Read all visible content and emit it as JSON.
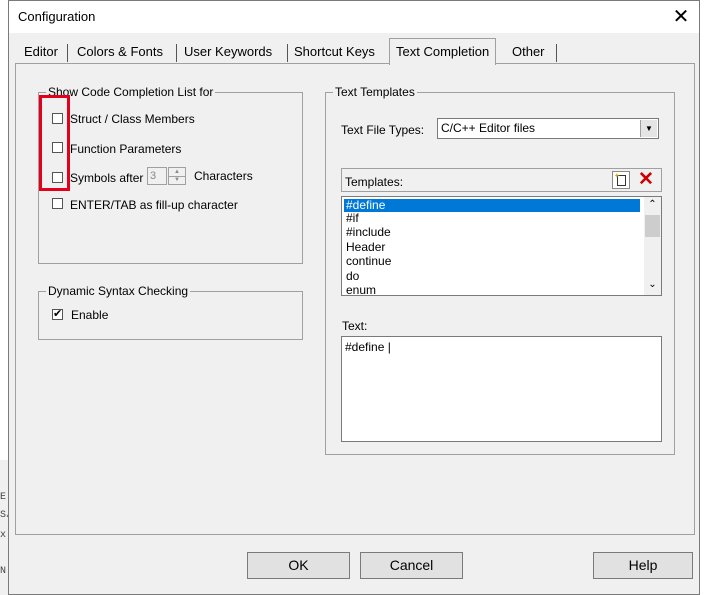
{
  "window": {
    "title": "Configuration"
  },
  "tabs": [
    {
      "label": "Editor"
    },
    {
      "label": "Colors & Fonts"
    },
    {
      "label": "User Keywords"
    },
    {
      "label": "Shortcut Keys"
    },
    {
      "label": "Text Completion"
    },
    {
      "label": "Other"
    }
  ],
  "active_tab": "Text Completion",
  "completion_group": {
    "title": "Show Code Completion List for",
    "struct_label": "Struct / Class Members",
    "struct_checked": false,
    "function_label": "Function Parameters",
    "function_checked": false,
    "symbols_label": "Symbols after",
    "symbols_checked": false,
    "symbols_count": "3",
    "characters_label": "Characters",
    "enter_tab_label": "ENTER/TAB as fill-up character",
    "enter_tab_checked": false
  },
  "syntax_group": {
    "title": "Dynamic Syntax Checking",
    "enable_label": "Enable",
    "enable_checked": true,
    "enable_mark": "✔"
  },
  "templates_group": {
    "title": "Text Templates",
    "file_types_label": "Text File Types:",
    "file_types_value": "C/C++ Editor files",
    "templates_label": "Templates:",
    "items": [
      "#define",
      "#if",
      "#include",
      "Header",
      "continue",
      "do",
      "enum"
    ],
    "selected_index": 0,
    "text_label": "Text:",
    "text_value": "#define |"
  },
  "buttons": {
    "ok": "OK",
    "cancel": "Cancel",
    "help": "Help"
  },
  "background_glyphs": [
    "E:",
    "S/",
    "x:",
    "N"
  ],
  "icons": {
    "close": "close-icon",
    "dropdown": "chevron-down-icon",
    "new": "new-template-icon",
    "delete": "delete-icon"
  },
  "colors": {
    "highlight": "#e3001b",
    "selection": "#0078d7",
    "dialog_bg": "#f0f0f0"
  }
}
